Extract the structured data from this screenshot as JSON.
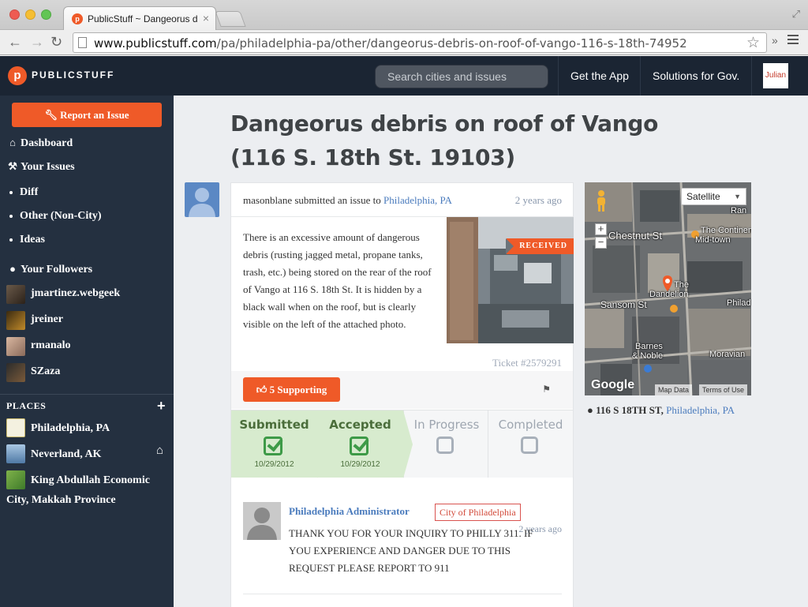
{
  "browser": {
    "tab_title": "PublicStuff ~ Dangeorus debris on roof",
    "tab_close": "×",
    "url_host": "www.publicstuff.com",
    "url_path": "/pa/philadelphia-pa/other/dangeorus-debris-on-roof-of-vango-116-s-18th-74952",
    "back": "←",
    "forward": "→",
    "reload": "↻",
    "star": "☆",
    "ext_more": "»",
    "fullscreen": "⤢",
    "favicon_letter": "p"
  },
  "header": {
    "logo_letter": "p",
    "logo_text": "PUBLICSTUFF",
    "search_placeholder": "Search cities and issues",
    "get_app": "Get the App",
    "solutions": "Solutions for Gov.",
    "user": "Julian"
  },
  "sidebar": {
    "report_button": "Report an Issue",
    "dashboard": "Dashboard",
    "your_issues": "Your Issues",
    "issue_categories": [
      "Diff",
      "Other (Non-City)",
      "Ideas"
    ],
    "your_followers": "Your Followers",
    "followers": [
      "jmartinez.webgeek",
      "jreiner",
      "rmanalo",
      "SZaza"
    ],
    "places_label": "PLACES",
    "places_add": "+",
    "places": [
      "Philadelphia, PA",
      "Neverland, AK",
      "King Abdullah Economic",
      "City, Makkah Province"
    ]
  },
  "issue": {
    "title": "Dangeorus debris on roof of Vango (116 S. 18th St. 19103)",
    "submitter": "masonblane",
    "submitted_text": "submitted an issue to",
    "city_link": "Philadelphia, PA",
    "time_ago": "2 years ago",
    "description": "There is an excessive amount of dangerous debris (rusting jagged metal, propane tanks, trash, etc.) being stored on the rear of the roof of Vango at 116 S. 18th St. It is hidden by a black wall when on the roof, but is clearly visible on the left of the attached photo.",
    "status_ribbon": "RECEIVED",
    "ticket": "Ticket #2579291",
    "support_button": "5 Supporting",
    "flag": "⚑",
    "steps": [
      {
        "label": "Submitted",
        "date": "10/29/2012",
        "done": true
      },
      {
        "label": "Accepted",
        "date": "10/29/2012",
        "done": true
      },
      {
        "label": "In Progress",
        "date": "",
        "done": false
      },
      {
        "label": "Completed",
        "date": "",
        "done": false
      }
    ]
  },
  "reply": {
    "author": "Philadelphia Administrator",
    "badge": "City of Philadelphia",
    "time_ago": "2 years ago",
    "text": "THANK YOU FOR YOUR INQUIRY TO PHILLY 311. IF YOU EXPERIENCE AND DANGER DUE TO THIS REQUEST PLEASE REPORT TO 911"
  },
  "map": {
    "type_select": "Satellite",
    "labels": [
      "Chestnut St",
      "The Continental",
      "Mid-town",
      "The",
      "Dandelion",
      "Sansom St",
      "Philad",
      "Barnes",
      "& Noble",
      "Moravian",
      "Ran"
    ],
    "zoom_in": "+",
    "zoom_out": "−",
    "google": "Google",
    "map_data": "Map Data",
    "terms": "Terms of Use"
  },
  "address": {
    "street": "116 S 18TH ST,",
    "city": "Philadelphia, PA"
  },
  "colors": {
    "accent": "#ef5a28",
    "header_bg": "#1b2533",
    "sidebar_bg": "#243040",
    "link": "#4a7bbd",
    "step_done_bg": "#d7ebce",
    "check_green": "#3d9a47"
  }
}
